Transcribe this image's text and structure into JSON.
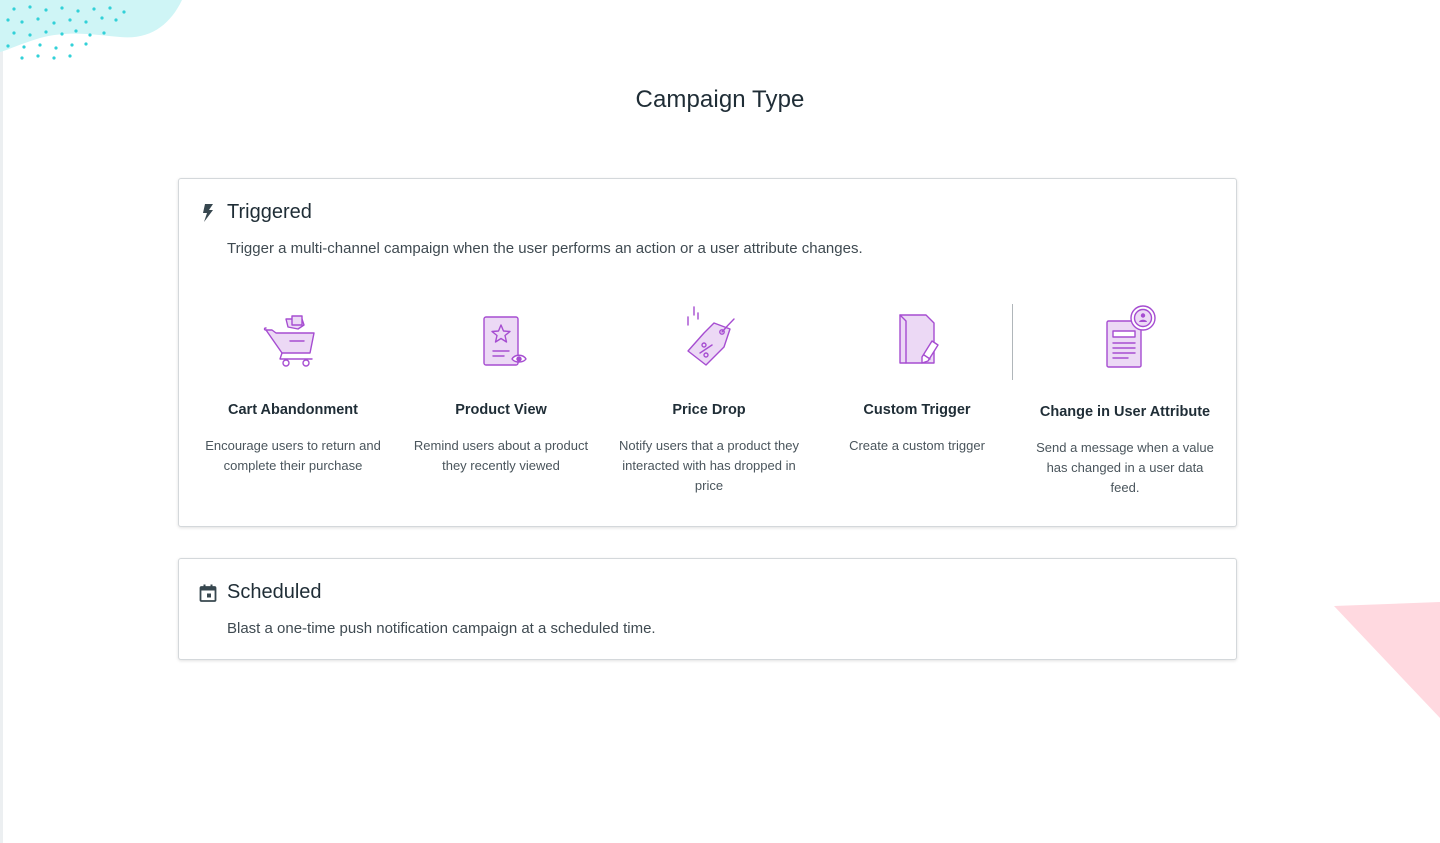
{
  "page": {
    "title": "Campaign Type"
  },
  "colors": {
    "accent_purple": "#a64dd1",
    "icon_fill": "#ecd9f5",
    "teal_decor": "#32d1d8",
    "pink_decor": "#ffd6de"
  },
  "triggered": {
    "icon": "lightning-bolt-icon",
    "title": "Triggered",
    "description": "Trigger a multi-channel campaign when the user performs an action or a user attribute changes.",
    "options": [
      {
        "icon": "shopping-cart-icon",
        "title": "Cart Abandonment",
        "description": "Encourage users to return and complete their purchase"
      },
      {
        "icon": "product-view-icon",
        "title": "Product View",
        "description": "Remind users about a product they recently viewed"
      },
      {
        "icon": "price-tag-icon",
        "title": "Price Drop",
        "description": "Notify users that a product they interacted with has dropped in price"
      },
      {
        "icon": "document-edit-icon",
        "title": "Custom Trigger",
        "description": "Create a custom trigger"
      },
      {
        "icon": "user-attribute-document-icon",
        "title": "Change in User Attribute",
        "description": "Send a message when a value has changed in a user data feed."
      }
    ]
  },
  "scheduled": {
    "icon": "calendar-icon",
    "title": "Scheduled",
    "description": "Blast a one-time push notification campaign at a scheduled time."
  }
}
